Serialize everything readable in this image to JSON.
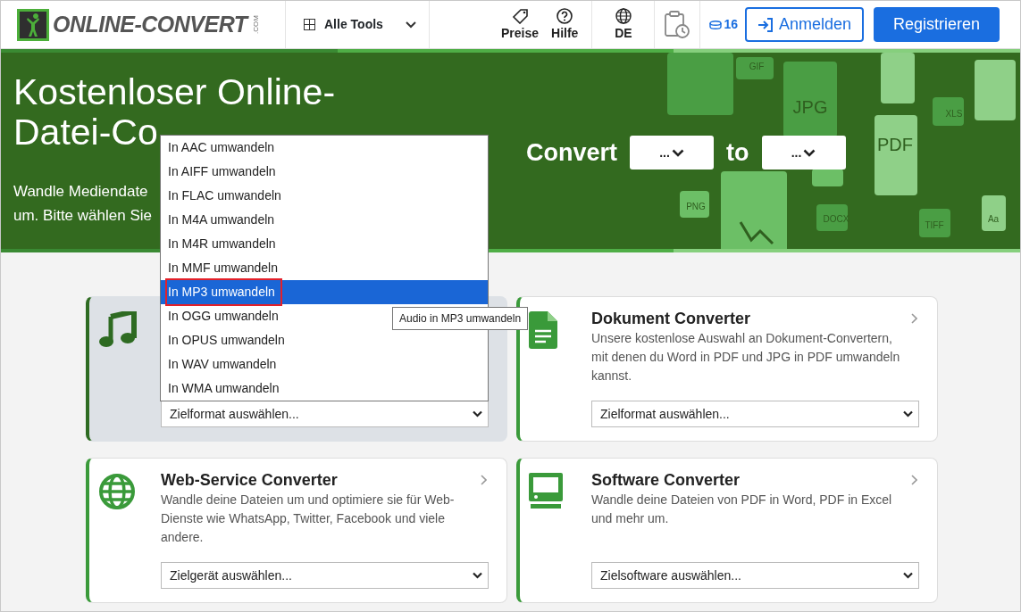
{
  "header": {
    "logo": {
      "name": "ONLINE-CONVERT",
      "suffix": ".COM"
    },
    "tools_menu": "Alle Tools",
    "nav": [
      {
        "kind": "tag",
        "label": "Preise"
      },
      {
        "kind": "help",
        "label": "Hilfe"
      }
    ],
    "language": "DE",
    "credits": "16",
    "login": "Anmelden",
    "register": "Registrieren"
  },
  "hero": {
    "title_lines": [
      "Kostenloser Online-",
      "Datei-Co"
    ],
    "text_lines": [
      "Wandle Mediendate",
      "um. Bitte wählen Sie"
    ],
    "convert": {
      "label": "Convert",
      "from": "...",
      "joiner": "to",
      "to": "..."
    },
    "decor_labels": [
      "GIF",
      "JPG",
      "XLS",
      "PDF",
      "PNG",
      "DOCX",
      "TIFF",
      "Aa"
    ]
  },
  "cards": [
    {
      "kind": "music",
      "hovered": true,
      "select": "Zielformat auswählen..."
    },
    {
      "kind": "document",
      "hovered": false,
      "title": "Dokument Converter",
      "description": "Unsere kostenlose Auswahl an Dokument-Convertern, mit denen du Word in PDF und JPG in PDF umwandeln kannst.",
      "select": "Zielformat auswählen..."
    },
    {
      "kind": "globe",
      "hovered": false,
      "title": "Web-Service Converter",
      "description": "Wandle deine Dateien um und optimiere sie für Web-Dienste wie WhatsApp, Twitter, Facebook und viele andere.",
      "select": "Zielgerät auswählen..."
    },
    {
      "kind": "monitor",
      "hovered": false,
      "title": "Software Converter",
      "description": "Wandle deine Dateien von PDF in Word, PDF in Excel und mehr um.",
      "select": "Zielsoftware auswählen..."
    }
  ],
  "dropdown": {
    "options": [
      {
        "label": "In AAC umwandeln",
        "selected": false
      },
      {
        "label": "In AIFF umwandeln",
        "selected": false
      },
      {
        "label": "In FLAC umwandeln",
        "selected": false
      },
      {
        "label": "In M4A umwandeln",
        "selected": false
      },
      {
        "label": "In M4R umwandeln",
        "selected": false
      },
      {
        "label": "In MMF umwandeln",
        "selected": false
      },
      {
        "label": "In MP3 umwandeln",
        "selected": true
      },
      {
        "label": "In OGG umwandeln",
        "selected": false
      },
      {
        "label": "In OPUS umwandeln",
        "selected": false
      },
      {
        "label": "In WAV umwandeln",
        "selected": false
      },
      {
        "label": "In WMA umwandeln",
        "selected": false
      }
    ],
    "tooltip": "Audio in MP3 umwandeln"
  }
}
